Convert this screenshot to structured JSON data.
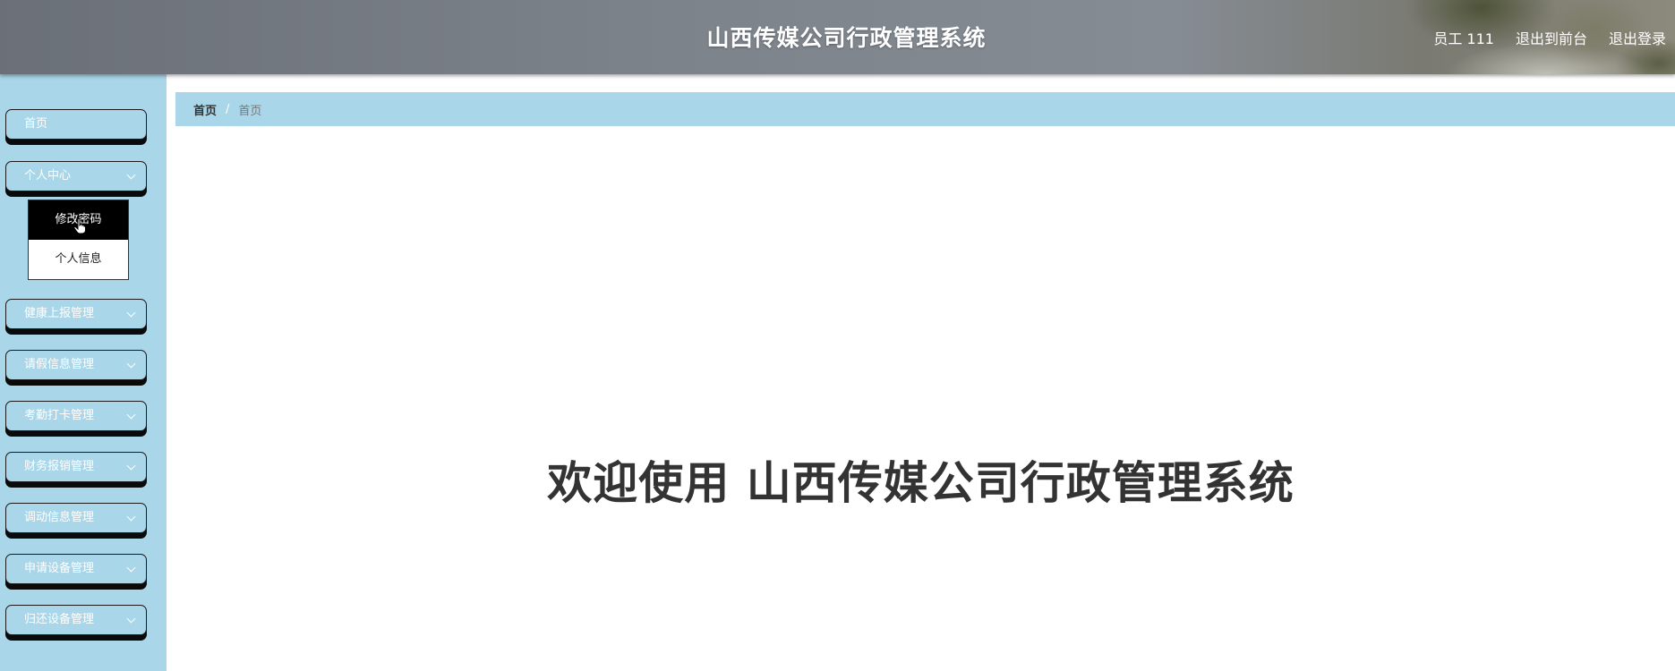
{
  "header": {
    "title": "山西传媒公司行政管理系统",
    "user": "员工 111",
    "to_front": "退出到前台",
    "logout": "退出登录"
  },
  "sidebar": {
    "items": [
      {
        "label": "首页"
      },
      {
        "label": "个人中心",
        "expanded": true,
        "children": [
          {
            "label": "修改密码",
            "active": true
          },
          {
            "label": "个人信息"
          }
        ]
      },
      {
        "label": "健康上报管理"
      },
      {
        "label": "请假信息管理"
      },
      {
        "label": "考勤打卡管理"
      },
      {
        "label": "财务报销管理"
      },
      {
        "label": "调动信息管理"
      },
      {
        "label": "申请设备管理"
      },
      {
        "label": "归还设备管理"
      }
    ]
  },
  "breadcrumb": {
    "home": "首页",
    "separator": "/",
    "current": "首页"
  },
  "main": {
    "welcome": "欢迎使用 山西传媒公司行政管理系统"
  },
  "colors": {
    "sidebar_bg": "#a9d6e8",
    "header_bg": "#7d838b",
    "active_item": "#000000"
  }
}
